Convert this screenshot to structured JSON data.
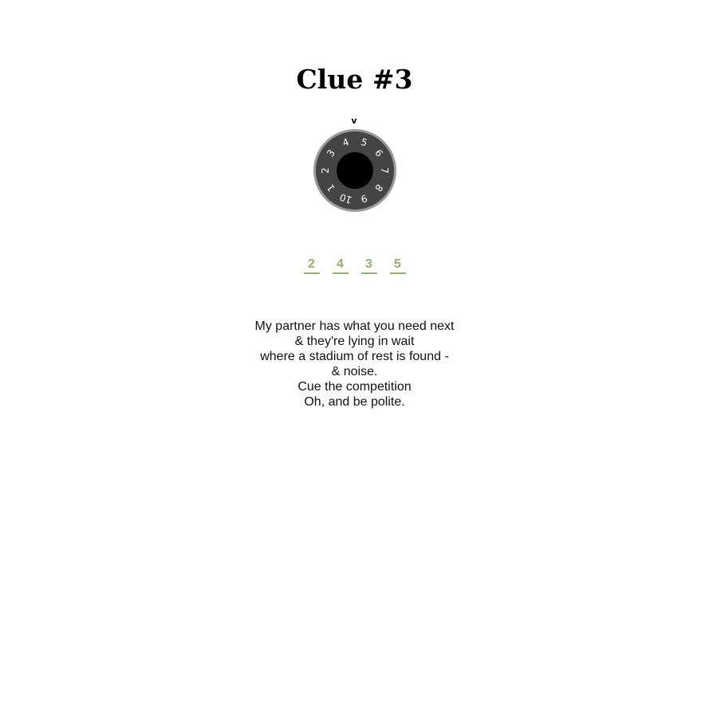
{
  "page": {
    "title": "Clue #3"
  },
  "dial": {
    "pointer_glyph": "v",
    "numbers": [
      "1",
      "2",
      "3",
      "4",
      "5",
      "6",
      "7",
      "8",
      "9",
      "10"
    ],
    "colors": {
      "rim": "#9a9a9a",
      "face": "#444444",
      "hub": "#000000",
      "numbers": "#ffffff"
    }
  },
  "code": {
    "digits": [
      "2",
      "4",
      "3",
      "5"
    ],
    "accent_color": "#8db36c"
  },
  "riddle": {
    "lines": [
      "My partner has what you need next",
      "& they're lying in wait",
      "where a stadium of rest is found -",
      "& noise.",
      "Cue the competition",
      "Oh, and be polite."
    ]
  }
}
